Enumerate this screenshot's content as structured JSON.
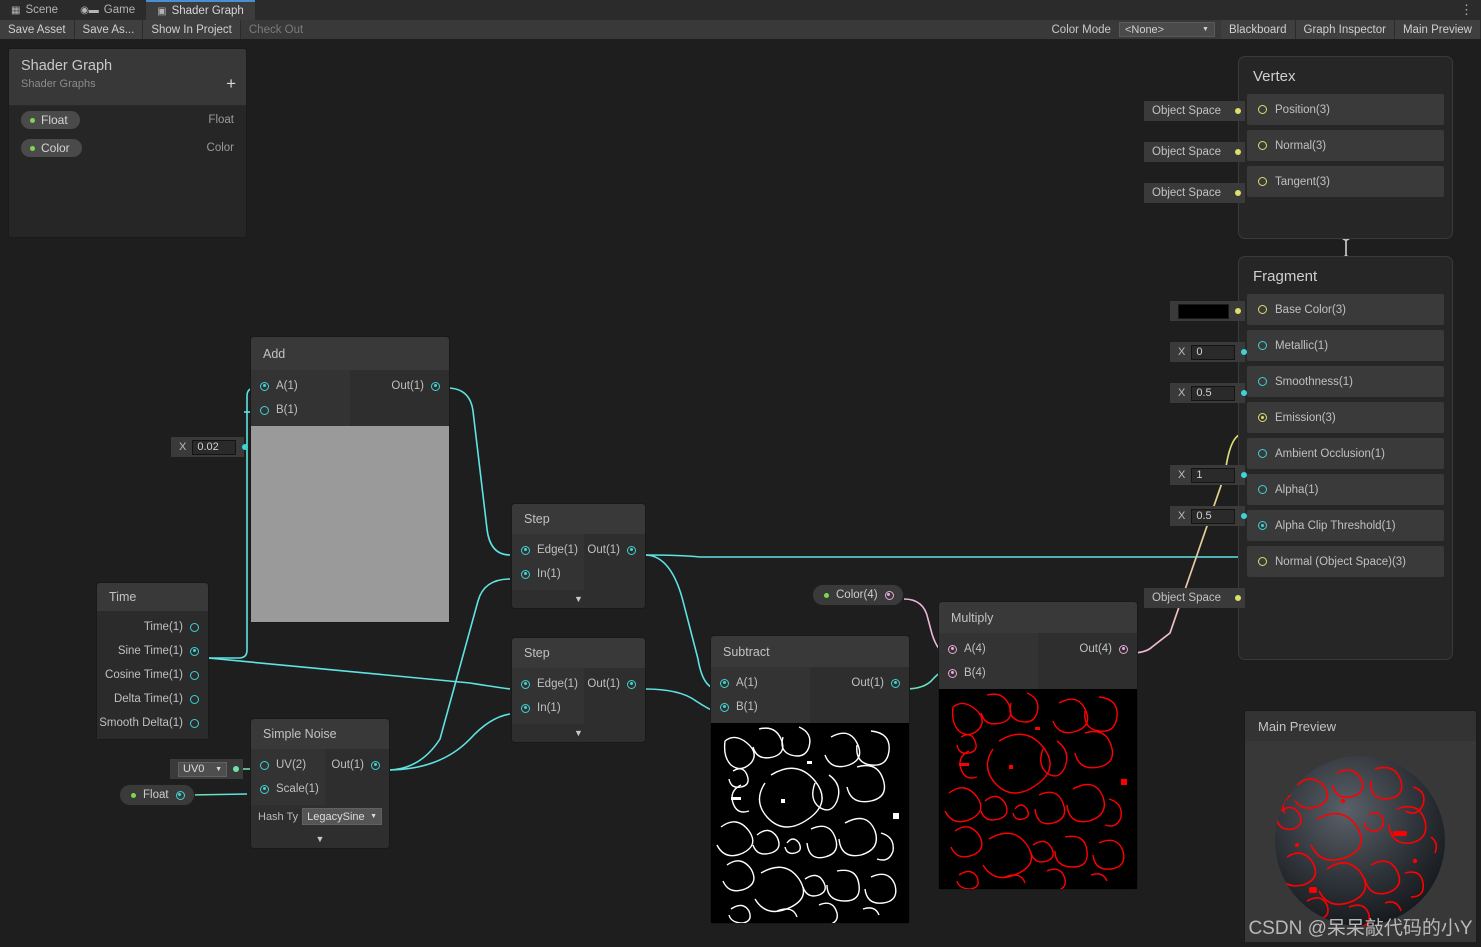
{
  "tabs": [
    {
      "label": "Scene",
      "icon": "grid-icon",
      "active": false
    },
    {
      "label": "Game",
      "icon": "gamepad-icon",
      "active": false
    },
    {
      "label": "Shader Graph",
      "icon": "shader-graph-icon",
      "active": true
    }
  ],
  "tab_menu_icon": "kebab-menu-icon",
  "toolbar": {
    "save_asset": "Save Asset",
    "save_as": "Save As...",
    "show_in_project": "Show In Project",
    "check_out": "Check Out",
    "color_mode_label": "Color Mode",
    "color_mode_value": "<None>",
    "blackboard": "Blackboard",
    "graph_inspector": "Graph Inspector",
    "main_preview": "Main Preview"
  },
  "blackboard": {
    "title": "Shader Graph",
    "subtitle": "Shader Graphs",
    "add_icon": "plus-icon",
    "properties": [
      {
        "name": "Float",
        "type": "Float"
      },
      {
        "name": "Color",
        "type": "Color"
      }
    ]
  },
  "nodes": {
    "add": {
      "title": "Add",
      "inputs": [
        {
          "label": "A(1)",
          "connected": true
        },
        {
          "label": "B(1)",
          "connected": false
        }
      ],
      "outputs": [
        {
          "label": "Out(1)",
          "connected": true
        }
      ],
      "default_value": "0.02",
      "default_axis": "X"
    },
    "time": {
      "title": "Time",
      "outputs": [
        {
          "label": "Time(1)",
          "connected": false
        },
        {
          "label": "Sine Time(1)",
          "connected": true
        },
        {
          "label": "Cosine Time(1)",
          "connected": false
        },
        {
          "label": "Delta Time(1)",
          "connected": false
        },
        {
          "label": "Smooth Delta(1)",
          "connected": false
        }
      ]
    },
    "simple_noise": {
      "title": "Simple Noise",
      "inputs": [
        {
          "label": "UV(2)",
          "connected": false
        },
        {
          "label": "Scale(1)",
          "connected": true
        }
      ],
      "outputs": [
        {
          "label": "Out(1)",
          "connected": true
        }
      ],
      "uv_channel": "UV0",
      "hash_label": "Hash Ty",
      "hash_value": "LegacySine",
      "expand_icon": "chevron-down-icon"
    },
    "step_top": {
      "title": "Step",
      "inputs": [
        {
          "label": "Edge(1)",
          "connected": true
        },
        {
          "label": "In(1)",
          "connected": true
        }
      ],
      "outputs": [
        {
          "label": "Out(1)",
          "connected": true
        }
      ],
      "expand_icon": "chevron-down-icon"
    },
    "step_bottom": {
      "title": "Step",
      "inputs": [
        {
          "label": "Edge(1)",
          "connected": true
        },
        {
          "label": "In(1)",
          "connected": true
        }
      ],
      "outputs": [
        {
          "label": "Out(1)",
          "connected": true
        }
      ],
      "expand_icon": "chevron-down-icon"
    },
    "subtract": {
      "title": "Subtract",
      "inputs": [
        {
          "label": "A(1)",
          "connected": true
        },
        {
          "label": "B(1)",
          "connected": true
        }
      ],
      "outputs": [
        {
          "label": "Out(1)",
          "connected": true
        }
      ]
    },
    "multiply": {
      "title": "Multiply",
      "inputs": [
        {
          "label": "A(4)",
          "connected": true
        },
        {
          "label": "B(4)",
          "connected": true
        }
      ],
      "outputs": [
        {
          "label": "Out(4)",
          "connected": true
        }
      ]
    },
    "prop_float": {
      "label": "Float"
    },
    "prop_color": {
      "label": "Color(4)"
    }
  },
  "vertex_block": {
    "title": "Vertex",
    "rows": [
      {
        "label": "Position(3)",
        "dock": "Object Space",
        "dock_type": "text",
        "connected": false
      },
      {
        "label": "Normal(3)",
        "dock": "Object Space",
        "dock_type": "text",
        "connected": false
      },
      {
        "label": "Tangent(3)",
        "dock": "Object Space",
        "dock_type": "text",
        "connected": false
      }
    ]
  },
  "fragment_block": {
    "title": "Fragment",
    "rows": [
      {
        "label": "Base Color(3)",
        "dock": "",
        "dock_type": "swatch",
        "dock_color": "#000000",
        "connected": false
      },
      {
        "label": "Metallic(1)",
        "dock": "0",
        "dock_type": "field",
        "axis": "X",
        "connected": false
      },
      {
        "label": "Smoothness(1)",
        "dock": "0.5",
        "dock_type": "field",
        "axis": "X",
        "connected": false
      },
      {
        "label": "Emission(3)",
        "dock": null,
        "dock_type": "none",
        "connected": true
      },
      {
        "label": "Ambient Occlusion(1)",
        "dock": "1",
        "dock_type": "field",
        "axis": "X",
        "connected": false
      },
      {
        "label": "Alpha(1)",
        "dock": "0.5",
        "dock_type": "field",
        "axis": "X",
        "connected": false
      },
      {
        "label": "Alpha Clip Threshold(1)",
        "dock": null,
        "dock_type": "none",
        "connected": true
      },
      {
        "label": "Normal (Object Space)(3)",
        "dock": "Object Space",
        "dock_type": "text",
        "connected": false
      }
    ]
  },
  "main_preview": {
    "title": "Main Preview"
  },
  "watermark": "CSDN @呆呆敲代码的小Y",
  "colors": {
    "wire_float": "#5fe3e3",
    "wire_vector": "#dede6e",
    "wire_color": "#f0b5dd",
    "accent_tab": "#4a8fd4",
    "property_dot": "#7fd64f",
    "preview_contour_red": "#ff0000",
    "preview_contour_white": "#ffffff"
  }
}
